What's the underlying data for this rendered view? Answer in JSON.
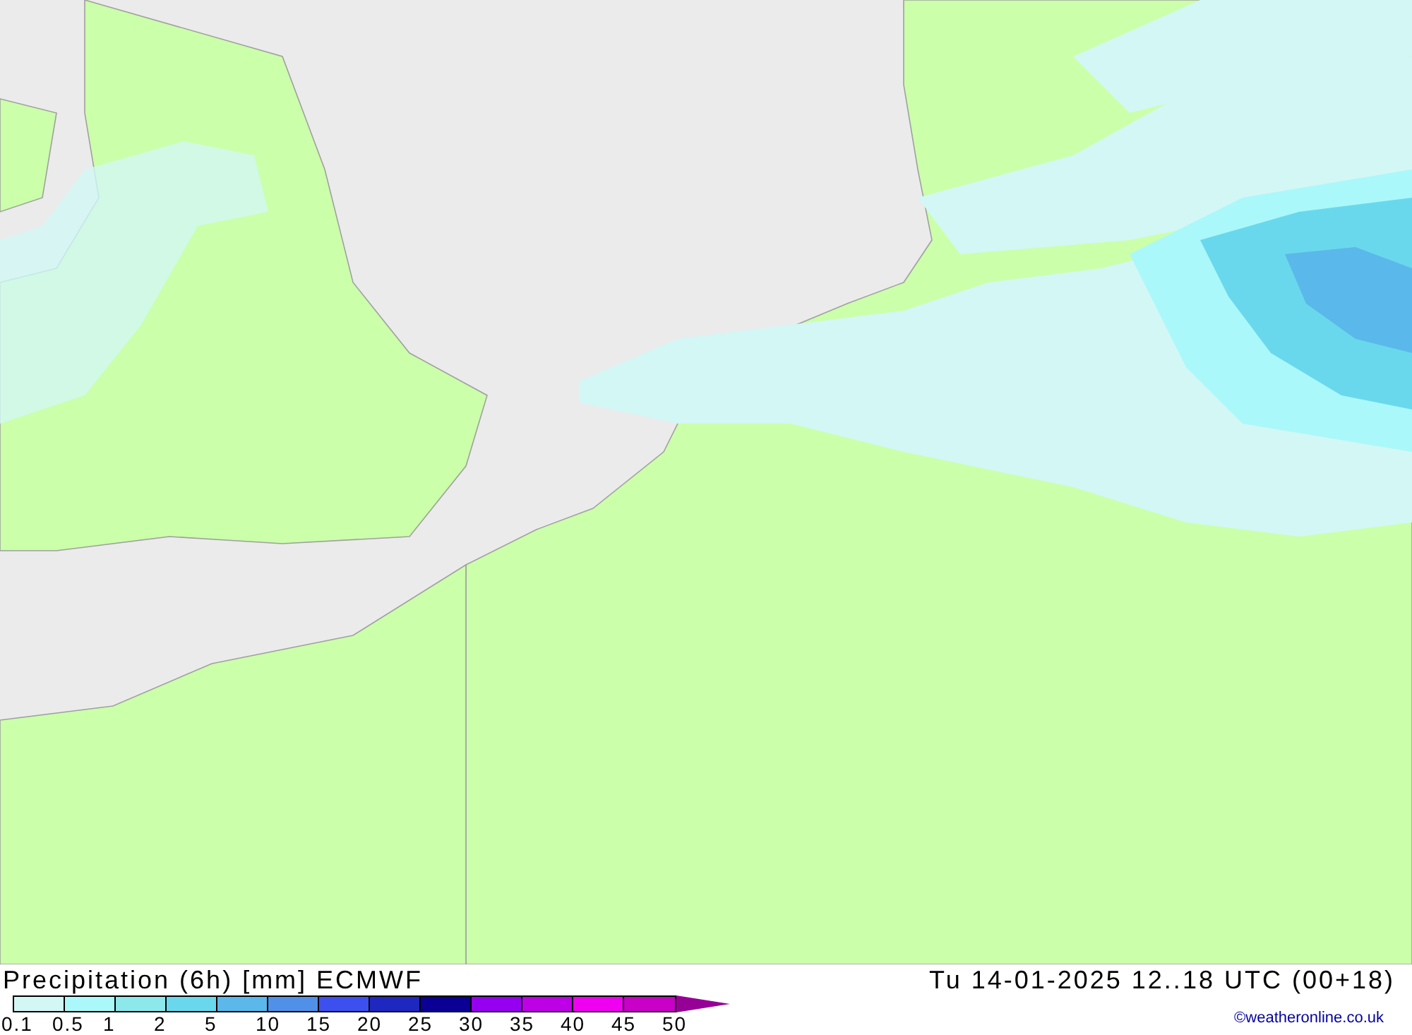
{
  "title": "Precipitation (6h) [mm] ECMWF",
  "valid_time": "Tu 14-01-2025 12..18 UTC (00+18)",
  "legend": {
    "bins": [
      {
        "color": "#d2f7f5"
      },
      {
        "color": "#aaf8fa"
      },
      {
        "color": "#8ce8ea"
      },
      {
        "color": "#6ad8ec"
      },
      {
        "color": "#5ab8ea"
      },
      {
        "color": "#5090e8"
      },
      {
        "color": "#3c50f0"
      },
      {
        "color": "#1e28c0"
      },
      {
        "color": "#0a0096"
      },
      {
        "color": "#9600f0"
      },
      {
        "color": "#be00e6"
      },
      {
        "color": "#f000f0"
      },
      {
        "color": "#c800c8"
      }
    ],
    "overflow": {
      "color": "#960096"
    },
    "labels": [
      "0.1",
      "0.5",
      "1",
      "2",
      "5",
      "10",
      "15",
      "20",
      "25",
      "30",
      "35",
      "40",
      "45",
      "50"
    ]
  },
  "credit": "©weatheronline.co.uk"
}
